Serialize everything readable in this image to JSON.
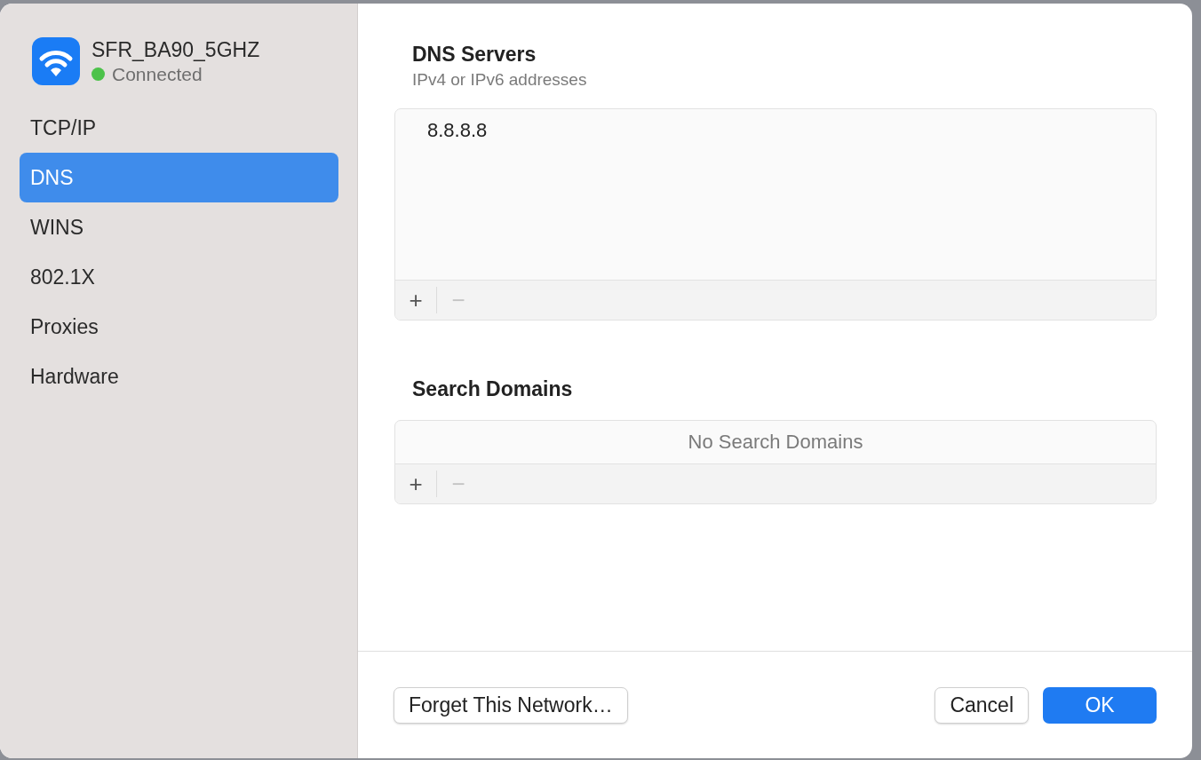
{
  "network": {
    "name": "SFR_BA90_5GHZ",
    "status": "Connected",
    "connected": true
  },
  "sidebar": {
    "items": [
      {
        "label": "TCP/IP",
        "selected": false
      },
      {
        "label": "DNS",
        "selected": true
      },
      {
        "label": "WINS",
        "selected": false
      },
      {
        "label": "802.1X",
        "selected": false
      },
      {
        "label": "Proxies",
        "selected": false
      },
      {
        "label": "Hardware",
        "selected": false
      }
    ]
  },
  "dns_servers": {
    "title": "DNS Servers",
    "subtitle": "IPv4 or IPv6 addresses",
    "entries": [
      "8.8.8.8"
    ],
    "add": {
      "label": "+",
      "disabled": false
    },
    "remove": {
      "label": "−",
      "disabled": true
    }
  },
  "search_domains": {
    "title": "Search Domains",
    "empty_text": "No Search Domains",
    "add": {
      "label": "+",
      "disabled": false
    },
    "remove": {
      "label": "−",
      "disabled": true
    }
  },
  "buttons": [
    {
      "label": "Forget This Network…",
      "kind": "secondary"
    },
    {
      "label": "Cancel",
      "kind": "secondary"
    },
    {
      "label": "OK",
      "kind": "primary"
    }
  ]
}
